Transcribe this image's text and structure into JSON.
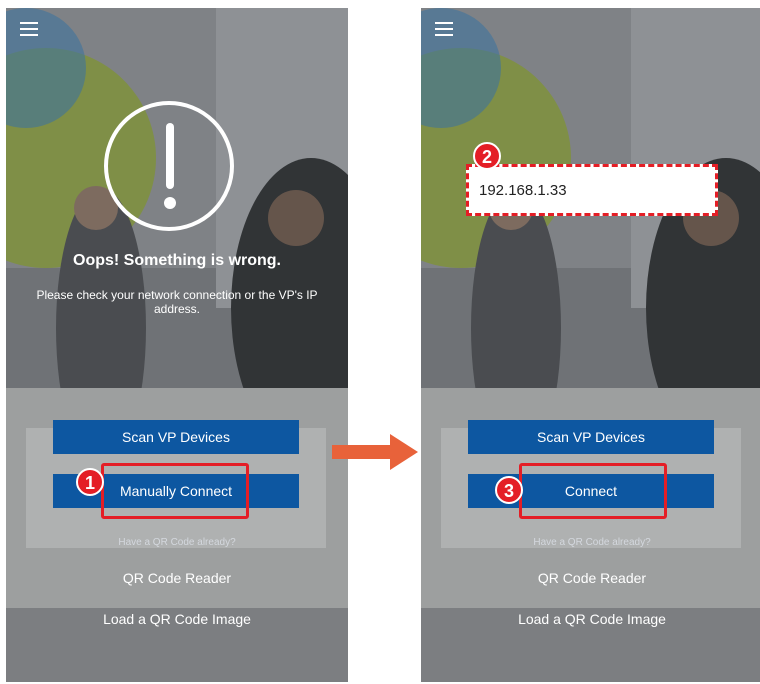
{
  "left_screen": {
    "menu_icon": "hamburger-menu-icon",
    "error_icon": "exclamation-circle-icon",
    "title": "Oops! Something is wrong.",
    "message": "Please check your network connection or the VP's IP address.",
    "scan_button": "Scan VP Devices",
    "manual_button": "Manually Connect",
    "qr_hint": "Have a QR Code already?",
    "qr_reader": "QR Code Reader",
    "load_qr": "Load a QR Code Image"
  },
  "right_screen": {
    "menu_icon": "hamburger-menu-icon",
    "ip_value": "192.168.1.33",
    "scan_button": "Scan VP Devices",
    "connect_button": "Connect",
    "qr_hint": "Have a QR Code already?",
    "qr_reader": "QR Code Reader",
    "load_qr": "Load a QR Code Image"
  },
  "steps": {
    "one": "1",
    "two": "2",
    "three": "3"
  },
  "colors": {
    "accent": "#e41e26",
    "button": "#0d57a1",
    "arrow": "#e8623a"
  },
  "transition_icon": "right-arrow-icon"
}
